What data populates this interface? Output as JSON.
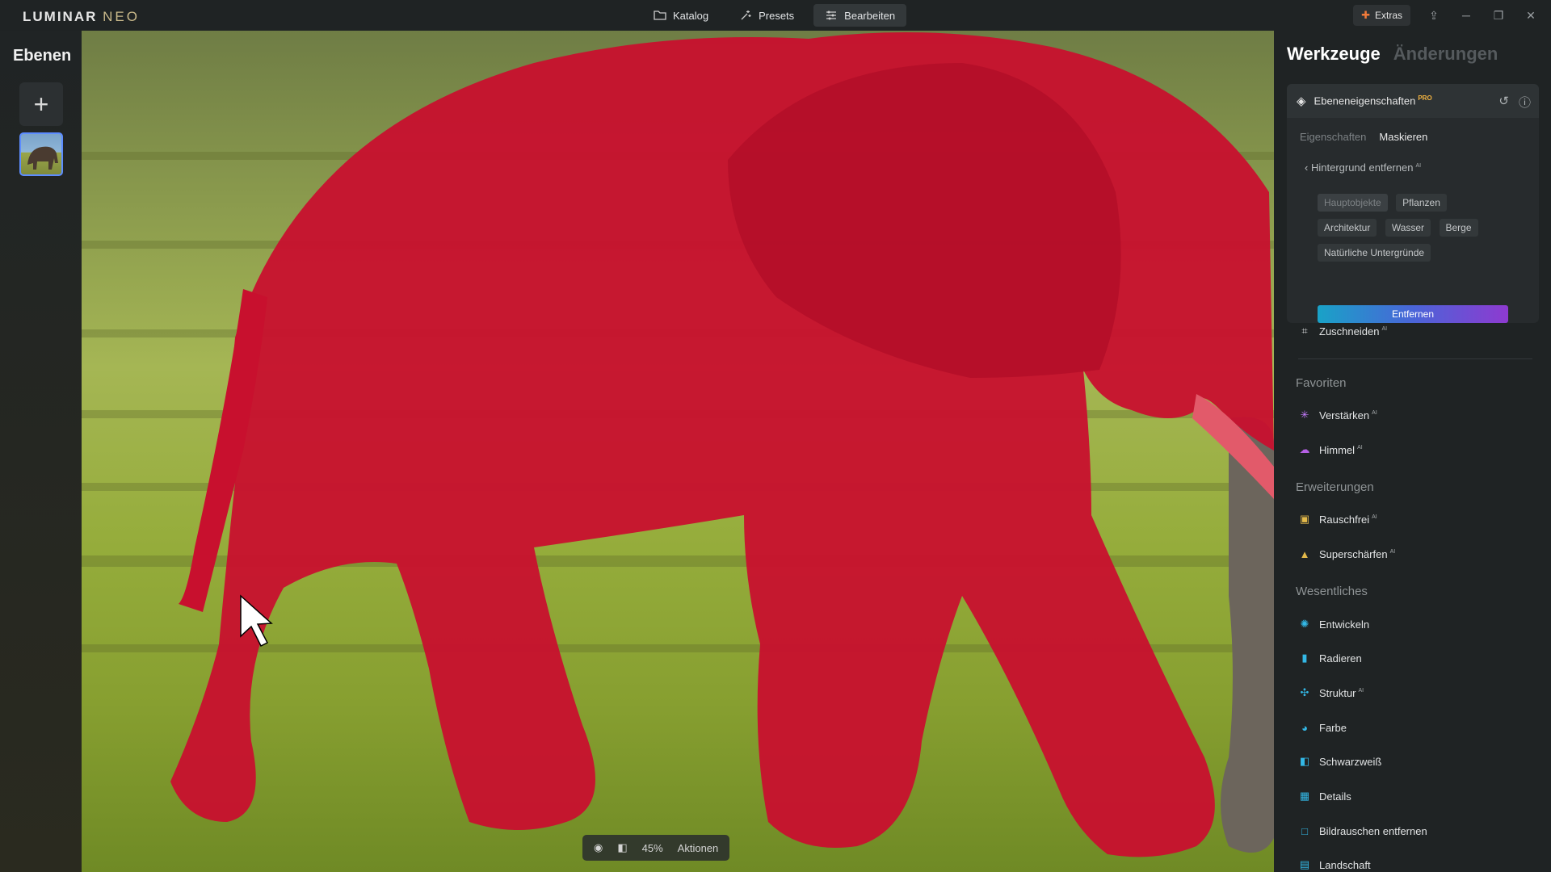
{
  "app": {
    "logo_main": "LUMINAR",
    "logo_sub": "NEO"
  },
  "topnav": [
    {
      "label": "Katalog",
      "icon": "folder-icon",
      "active": false
    },
    {
      "label": "Presets",
      "icon": "presets-icon",
      "active": false
    },
    {
      "label": "Bearbeiten",
      "icon": "sliders-icon",
      "active": true
    }
  ],
  "topright": {
    "extras_label": "Extras"
  },
  "layers": {
    "title": "Ebenen"
  },
  "canvas": {
    "zoom": "45%",
    "actions_label": "Aktionen"
  },
  "rightpanel": {
    "tab_tools": "Werkzeuge",
    "tab_changes": "Änderungen",
    "layer_props": {
      "title": "Ebeneneigenschaften",
      "badge": "PRO",
      "subtab_properties": "Eigenschaften",
      "subtab_mask": "Maskieren",
      "back_label": "Hintergrund entfernen",
      "back_badge": "AI",
      "chips": [
        "Hauptobjekte",
        "Pflanzen",
        "Architektur",
        "Wasser",
        "Berge",
        "Natürliche Untergründe"
      ],
      "remove_label": "Entfernen"
    },
    "crop": {
      "label": "Zuschneiden",
      "badge": "AI"
    },
    "sections": {
      "favorites": "Favoriten",
      "extensions": "Erweiterungen",
      "essentials": "Wesentliches"
    },
    "favorites": [
      {
        "label": "Verstärken",
        "badge": "AI",
        "icon": "sparkle-icon",
        "color": "#c77dff"
      },
      {
        "label": "Himmel",
        "badge": "AI",
        "icon": "cloud-icon",
        "color": "#b660e6"
      }
    ],
    "extensions": [
      {
        "label": "Rauschfrei",
        "badge": "AI",
        "icon": "noiseless-icon",
        "color": "#e3b94a"
      },
      {
        "label": "Superschärfen",
        "badge": "AI",
        "icon": "sharpen-icon",
        "color": "#e3b94a"
      }
    ],
    "essentials": [
      {
        "label": "Entwickeln",
        "badge": "",
        "icon": "sun-icon",
        "color": "#33b8e6"
      },
      {
        "label": "Radieren",
        "badge": "",
        "icon": "eraser-icon",
        "color": "#33b8e6"
      },
      {
        "label": "Struktur",
        "badge": "AI",
        "icon": "structure-icon",
        "color": "#33b8e6"
      },
      {
        "label": "Farbe",
        "badge": "",
        "icon": "color-icon",
        "color": "#33b8e6"
      },
      {
        "label": "Schwarzweiß",
        "badge": "",
        "icon": "bw-icon",
        "color": "#33b8e6"
      },
      {
        "label": "Details",
        "badge": "",
        "icon": "details-icon",
        "color": "#33b8e6"
      },
      {
        "label": "Bildrauschen entfernen",
        "badge": "",
        "icon": "denoise-icon",
        "color": "#33b8e6"
      },
      {
        "label": "Landschaft",
        "badge": "",
        "icon": "landscape-icon",
        "color": "#33b8e6"
      }
    ]
  }
}
